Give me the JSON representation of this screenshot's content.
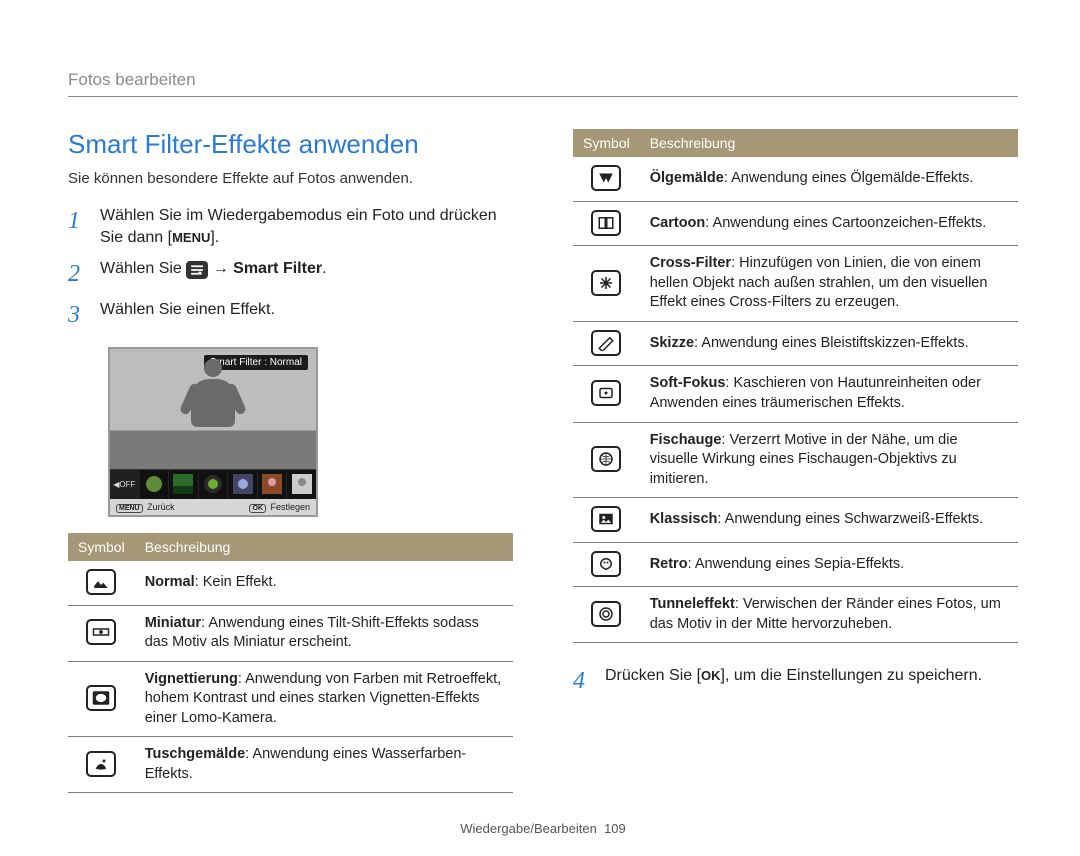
{
  "header": "Fotos bearbeiten",
  "title": "Smart Filter-Effekte anwenden",
  "intro": "Sie können besondere Effekte auf Fotos anwenden.",
  "steps": {
    "s1a": "Wählen Sie im Wiedergabemodus ein Foto und drücken Sie dann [",
    "s1b": "].",
    "s2a": "Wählen Sie ",
    "s2b": " → ",
    "s2c": "Smart Filter",
    "s2d": ".",
    "s3": "Wählen Sie einen Effekt.",
    "s4a": "Drücken Sie [",
    "s4b": "], um die Einstellungen zu speichern."
  },
  "menu_label": "MENU",
  "ok_label": "OK",
  "screen": {
    "tag": "Smart Filter : Normal",
    "off": "OFF",
    "back_pill": "MENU",
    "back_label": "Zurück",
    "set_pill": "OK",
    "set_label": "Festlegen"
  },
  "table_headers": {
    "symbol": "Symbol",
    "desc": "Beschreibung"
  },
  "left_rows": [
    {
      "name": "Normal",
      "desc": ": Kein Effekt."
    },
    {
      "name": "Miniatur",
      "desc": ": Anwendung eines Tilt-Shift-Effekts sodass das Motiv als Miniatur erscheint."
    },
    {
      "name": "Vignettierung",
      "desc": ": Anwendung von Farben mit Retroeffekt, hohem Kontrast und eines starken Vignetten-Effekts einer Lomo-Kamera."
    },
    {
      "name": "Tuschgemälde",
      "desc": ": Anwendung eines Wasserfarben-Effekts."
    }
  ],
  "right_rows": [
    {
      "name": "Ölgemälde",
      "desc": ": Anwendung eines Ölgemälde-Effekts."
    },
    {
      "name": "Cartoon",
      "desc": ": Anwendung eines Cartoonzeichen-Effekts."
    },
    {
      "name": "Cross-Filter",
      "desc": ": Hinzufügen von Linien, die von einem hellen Objekt nach außen strahlen, um den visuellen Effekt eines Cross-Filters zu erzeugen."
    },
    {
      "name": "Skizze",
      "desc": ": Anwendung eines Bleistiftskizzen-Effekts."
    },
    {
      "name": "Soft-Fokus",
      "desc": ": Kaschieren von Hautunreinheiten oder Anwenden eines träumerischen Effekts."
    },
    {
      "name": "Fischauge",
      "desc": ": Verzerrt Motive in der Nähe, um die visuelle Wirkung eines Fischaugen-Objektivs zu imitieren."
    },
    {
      "name": "Klassisch",
      "desc": ": Anwendung eines Schwarzweiß-Effekts."
    },
    {
      "name": "Retro",
      "desc": ": Anwendung eines Sepia-Effekts."
    },
    {
      "name": "Tunneleffekt",
      "desc": ": Verwischen der Ränder eines Fotos, um das Motiv in der Mitte hervorzuheben."
    }
  ],
  "footer": {
    "section": "Wiedergabe/Bearbeiten",
    "page": "109"
  }
}
